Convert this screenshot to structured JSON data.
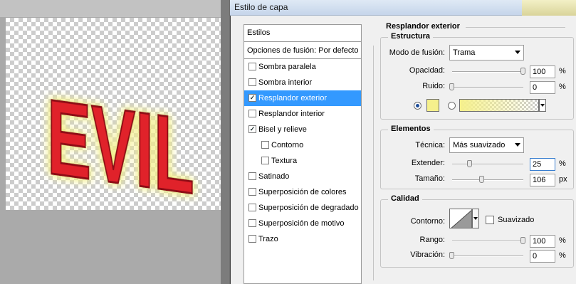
{
  "canvas": {
    "artwork_text": "EVIL"
  },
  "dialog": {
    "title": "Estilo de capa"
  },
  "styles_list": {
    "header": "Estilos",
    "blend_options": "Opciones de fusión: Por defecto",
    "items": [
      {
        "label": "Sombra paralela",
        "checked": false,
        "sub": false,
        "active": false
      },
      {
        "label": "Sombra interior",
        "checked": false,
        "sub": false,
        "active": false
      },
      {
        "label": "Resplandor exterior",
        "checked": true,
        "sub": false,
        "active": true
      },
      {
        "label": "Resplandor interior",
        "checked": false,
        "sub": false,
        "active": false
      },
      {
        "label": "Bisel y relieve",
        "checked": true,
        "sub": false,
        "active": false
      },
      {
        "label": "Contorno",
        "checked": false,
        "sub": true,
        "active": false
      },
      {
        "label": "Textura",
        "checked": false,
        "sub": true,
        "active": false
      },
      {
        "label": "Satinado",
        "checked": false,
        "sub": false,
        "active": false
      },
      {
        "label": "Superposición de colores",
        "checked": false,
        "sub": false,
        "active": false
      },
      {
        "label": "Superposición de degradado",
        "checked": false,
        "sub": false,
        "active": false
      },
      {
        "label": "Superposición de motivo",
        "checked": false,
        "sub": false,
        "active": false
      },
      {
        "label": "Trazo",
        "checked": false,
        "sub": false,
        "active": false
      }
    ]
  },
  "outer_glow": {
    "title": "Resplandor exterior",
    "structure": {
      "title": "Estructura",
      "blend_mode_label": "Modo de fusión:",
      "blend_mode_value": "Trama",
      "opacity_label": "Opacidad:",
      "opacity_value": "100",
      "opacity_level": 1.0,
      "noise_label": "Ruido:",
      "noise_value": "0",
      "noise_level": 0.0,
      "percent": "%",
      "glow_color": "#f5f08c"
    },
    "elements": {
      "title": "Elementos",
      "technique_label": "Técnica:",
      "technique_value": "Más suavizado",
      "spread_label": "Extender:",
      "spread_value": "25",
      "spread_level": 0.25,
      "size_label": "Tamaño:",
      "size_value": "106",
      "size_level": 0.42,
      "percent": "%",
      "px": "px"
    },
    "quality": {
      "title": "Calidad",
      "contour_label": "Contorno:",
      "antialias_label": "Suavizado",
      "range_label": "Rango:",
      "range_value": "100",
      "range_level": 1.0,
      "jitter_label": "Vibración:",
      "jitter_value": "0",
      "jitter_level": 0.0,
      "percent": "%"
    }
  }
}
